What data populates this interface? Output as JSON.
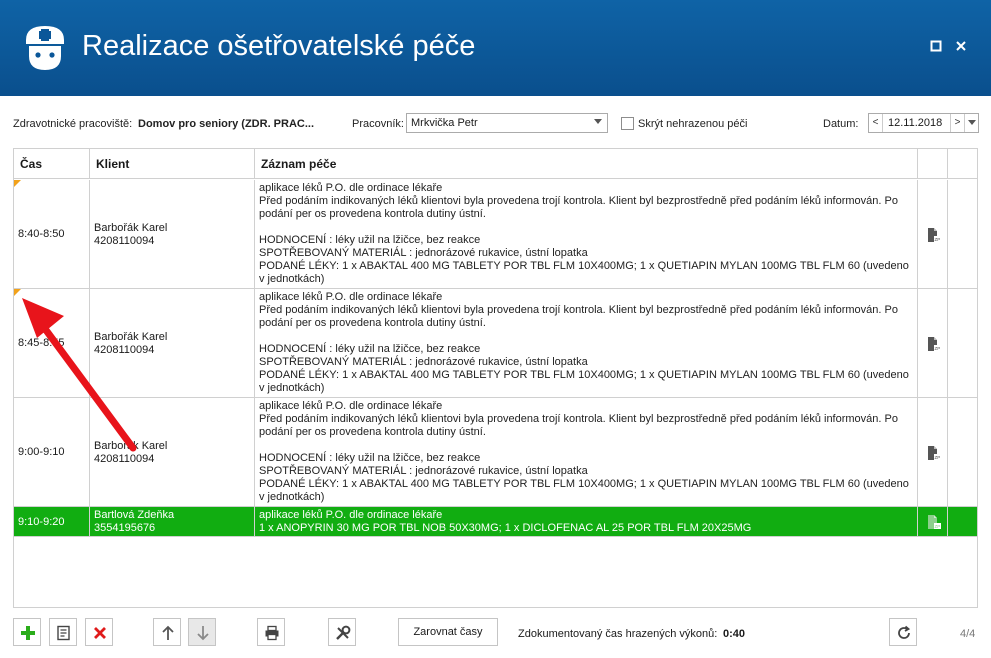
{
  "window": {
    "title": "Realizace ošetřovatelské péče",
    "app_icon": "nurse-icon",
    "maximize_icon": "maximize-icon",
    "close_icon": "close-icon"
  },
  "filters": {
    "workplace_label": "Zdravotnické pracoviště:",
    "workplace_value": "Domov pro seniory (ZDR. PRAC...",
    "worker_label": "Pracovník:",
    "worker_value": "Mrkvička Petr",
    "hide_unpaid_label": "Skrýt nehrazenou péči",
    "hide_unpaid_checked": false,
    "date_label": "Datum:",
    "date_value": "12.11.2018",
    "prev_symbol": "<",
    "next_symbol": ">"
  },
  "grid": {
    "columns": [
      "Čas",
      "Klient",
      "Záznam péče"
    ],
    "rows": [
      {
        "time": "8:40-8:50",
        "client_name": "Barbořák Karel",
        "client_id": "4208110094",
        "care": "aplikace léků P.O. dle ordinace lékaře\nPřed podáním indikovaných léků klientovi byla provedena trojí kontrola. Klient byl bezprostředně před podáním léků informován. Po podání per os provedena kontrola dutiny ústní.\n\nHODNOCENÍ : léky užil na lžičce, bez reakce\nSPOTŘEBOVANÝ MATERIÁL : jednorázové rukavice, ústní lopatka\nPODANÉ LÉKY: 1 x ABAKTAL 400 MG TABLETY POR TBL FLM 10X400MG; 1 x QUETIAPIN MYLAN 100MG TBL FLM 60 (uvedeno v jednotkách)",
        "flag": true,
        "selected": false,
        "doc_icon": "zp-document-icon"
      },
      {
        "time": "8:45-8:55",
        "client_name": "Barbořák Karel",
        "client_id": "4208110094",
        "care": "aplikace léků P.O. dle ordinace lékaře\nPřed podáním indikovaných léků klientovi byla provedena trojí kontrola. Klient byl bezprostředně před podáním léků informován. Po podání per os provedena kontrola dutiny ústní.\n\nHODNOCENÍ : léky užil na lžičce, bez reakce\nSPOTŘEBOVANÝ MATERIÁL : jednorázové rukavice, ústní lopatka\nPODANÉ LÉKY: 1 x ABAKTAL 400 MG TABLETY POR TBL FLM 10X400MG; 1 x QUETIAPIN MYLAN 100MG TBL FLM 60 (uvedeno v jednotkách)",
        "flag": true,
        "selected": false,
        "doc_icon": "zp-document-icon"
      },
      {
        "time": "9:00-9:10",
        "client_name": "Barbořák Karel",
        "client_id": "4208110094",
        "care": "aplikace léků P.O. dle ordinace lékaře\nPřed podáním indikovaných léků klientovi byla provedena trojí kontrola. Klient byl bezprostředně před podáním léků informován. Po podání per os provedena kontrola dutiny ústní.\n\nHODNOCENÍ : léky užil na lžičce, bez reakce\nSPOTŘEBOVANÝ MATERIÁL : jednorázové rukavice, ústní lopatka\nPODANÉ LÉKY: 1 x ABAKTAL 400 MG TABLETY POR TBL FLM 10X400MG; 1 x QUETIAPIN MYLAN 100MG TBL FLM 60 (uvedeno v jednotkách)",
        "flag": false,
        "selected": false,
        "doc_icon": "zp-document-icon"
      },
      {
        "time": "9:10-9:20",
        "client_name": "Bartlová Zdeňka",
        "client_id": "3554195676",
        "care": "aplikace léků P.O. dle ordinace lékaře\n1 x ANOPYRIN 30 MG POR TBL NOB 50X30MG; 1 x DICLOFENAC AL 25 POR TBL FLM 20X25MG",
        "flag": false,
        "selected": true,
        "doc_icon": "zp-document-icon"
      }
    ]
  },
  "toolbar": {
    "add_icon": "plus-icon",
    "edit_icon": "edit-icon",
    "delete_icon": "delete-icon",
    "up_icon": "arrow-up-icon",
    "down_icon": "arrow-down-icon",
    "print_icon": "print-icon",
    "tools_icon": "tools-icon",
    "align_label": "Zarovnat časy",
    "documented_label": "Zdokumentovaný čas hrazených výkonů:",
    "documented_value": "0:40",
    "refresh_icon": "refresh-icon",
    "counter": "4/4"
  },
  "annotation": {
    "arrow_color": "#e8141b"
  },
  "colors": {
    "titlebar": "#0b5799",
    "selected_row": "#11ad11",
    "flag": "#f2a21b"
  }
}
